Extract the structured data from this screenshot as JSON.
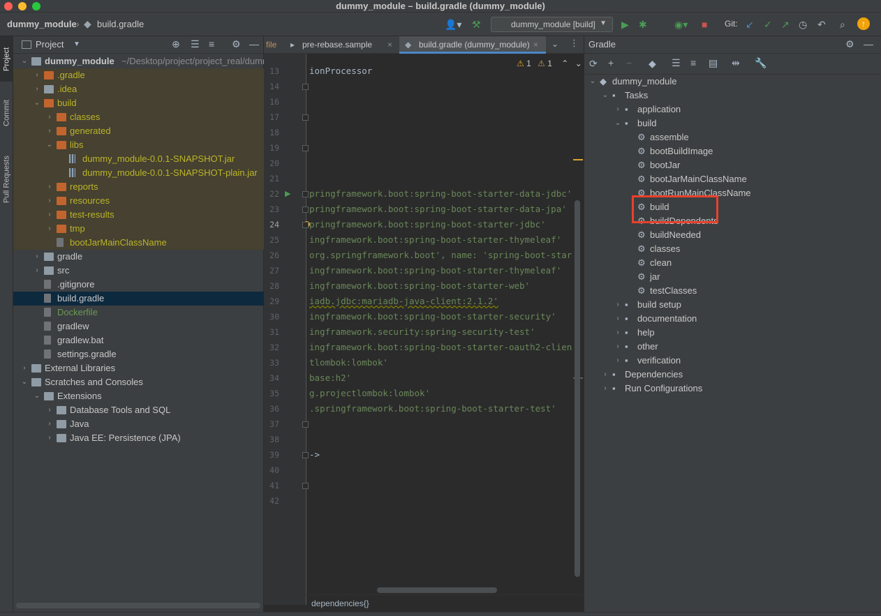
{
  "window": {
    "title": "dummy_module – build.gradle (dummy_module)"
  },
  "navbar": {
    "project": "dummy_module",
    "file": "build.gradle",
    "run_config": "dummy_module [build]",
    "git_label": "Git:"
  },
  "stripe": {
    "tabs": [
      "Project",
      "Commit",
      "Pull Requests"
    ]
  },
  "project_panel": {
    "title": "Project",
    "rows": [
      {
        "name": "dummy_module",
        "path": "~/Desktop/project/project_real/dummy_module",
        "depth": 0,
        "arrow": "down",
        "icon": "folder-gray",
        "color": "white",
        "bold": true
      },
      {
        "name": ".gradle",
        "depth": 1,
        "arrow": "right",
        "icon": "folder-orange",
        "color": "olive",
        "tinted": true
      },
      {
        "name": ".idea",
        "depth": 1,
        "arrow": "right",
        "icon": "folder-gray",
        "color": "olive",
        "tinted": true
      },
      {
        "name": "build",
        "depth": 1,
        "arrow": "down",
        "icon": "folder-orange",
        "color": "olive",
        "tinted": true
      },
      {
        "name": "classes",
        "depth": 2,
        "arrow": "right",
        "icon": "folder-orange",
        "color": "olive",
        "tinted": true
      },
      {
        "name": "generated",
        "depth": 2,
        "arrow": "right",
        "icon": "folder-orange",
        "color": "olive",
        "tinted": true
      },
      {
        "name": "libs",
        "depth": 2,
        "arrow": "down",
        "icon": "folder-orange",
        "color": "olive",
        "tinted": true
      },
      {
        "name": "dummy_module-0.0.1-SNAPSHOT.jar",
        "depth": 3,
        "arrow": "",
        "icon": "jar",
        "color": "olive",
        "tinted": true
      },
      {
        "name": "dummy_module-0.0.1-SNAPSHOT-plain.jar",
        "depth": 3,
        "arrow": "",
        "icon": "jar",
        "color": "olive",
        "tinted": true
      },
      {
        "name": "reports",
        "depth": 2,
        "arrow": "right",
        "icon": "folder-orange",
        "color": "olive",
        "tinted": true
      },
      {
        "name": "resources",
        "depth": 2,
        "arrow": "right",
        "icon": "folder-orange",
        "color": "olive",
        "tinted": true
      },
      {
        "name": "test-results",
        "depth": 2,
        "arrow": "right",
        "icon": "folder-orange",
        "color": "olive",
        "tinted": true
      },
      {
        "name": "tmp",
        "depth": 2,
        "arrow": "right",
        "icon": "folder-orange",
        "color": "olive",
        "tinted": true
      },
      {
        "name": "bootJarMainClassName",
        "depth": 2,
        "arrow": "",
        "icon": "file",
        "color": "olive",
        "tinted": true
      },
      {
        "name": "gradle",
        "depth": 1,
        "arrow": "right",
        "icon": "folder-gray",
        "color": "white"
      },
      {
        "name": "src",
        "depth": 1,
        "arrow": "right",
        "icon": "folder-gray",
        "color": "white"
      },
      {
        "name": ".gitignore",
        "depth": 1,
        "arrow": "",
        "icon": "file",
        "color": "white"
      },
      {
        "name": "build.gradle",
        "depth": 1,
        "arrow": "",
        "icon": "file",
        "color": "white",
        "selected": true
      },
      {
        "name": "Dockerfile",
        "depth": 1,
        "arrow": "",
        "icon": "file",
        "color": "green"
      },
      {
        "name": "gradlew",
        "depth": 1,
        "arrow": "",
        "icon": "file",
        "color": "white"
      },
      {
        "name": "gradlew.bat",
        "depth": 1,
        "arrow": "",
        "icon": "file",
        "color": "white"
      },
      {
        "name": "settings.gradle",
        "depth": 1,
        "arrow": "",
        "icon": "file",
        "color": "white"
      },
      {
        "name": "External Libraries",
        "depth": 0,
        "arrow": "right",
        "icon": "folder-gray",
        "color": "white"
      },
      {
        "name": "Scratches and Consoles",
        "depth": 0,
        "arrow": "down",
        "icon": "folder-gray",
        "color": "white"
      },
      {
        "name": "Extensions",
        "depth": 1,
        "arrow": "down",
        "icon": "folder-gray",
        "color": "white"
      },
      {
        "name": "Database Tools and SQL",
        "depth": 2,
        "arrow": "right",
        "icon": "folder-gray",
        "color": "white"
      },
      {
        "name": "Java",
        "depth": 2,
        "arrow": "right",
        "icon": "folder-gray",
        "color": "white"
      },
      {
        "name": "Java EE: Persistence (JPA)",
        "depth": 2,
        "arrow": "right",
        "icon": "folder-gray",
        "color": "white"
      }
    ]
  },
  "editor": {
    "tabs": [
      {
        "label": "file",
        "active": false
      },
      {
        "label": "pre-rebase.sample",
        "active": false
      },
      {
        "label": "build.gradle (dummy_module)",
        "active": true
      }
    ],
    "warnings": "1",
    "weak_warnings": "1",
    "lines": [
      {
        "n": "13",
        "text": "ionProcessor",
        "kind": "plain"
      },
      {
        "n": "14",
        "text": "",
        "kind": "plain"
      },
      {
        "n": "16",
        "text": "",
        "kind": "plain"
      },
      {
        "n": "17",
        "text": "",
        "kind": "plain"
      },
      {
        "n": "18",
        "text": "",
        "kind": "plain"
      },
      {
        "n": "19",
        "text": "",
        "kind": "plain"
      },
      {
        "n": "20",
        "text": "",
        "kind": "plain"
      },
      {
        "n": "21",
        "text": "",
        "kind": "plain"
      },
      {
        "n": "22",
        "text": "pringframework.boot:spring-boot-starter-data-jdbc'",
        "kind": "str"
      },
      {
        "n": "23",
        "text": "pringframework.boot:spring-boot-starter-data-jpa'",
        "kind": "str"
      },
      {
        "n": "24",
        "text": "pringframework.boot:spring-boot-starter-jdbc'",
        "kind": "str"
      },
      {
        "n": "25",
        "text": "ingframework.boot:spring-boot-starter-thymeleaf'",
        "kind": "str"
      },
      {
        "n": "26",
        "text": "org.springframework.boot', name: 'spring-boot-star",
        "kind": "str"
      },
      {
        "n": "27",
        "text": "ingframework.boot:spring-boot-starter-thymeleaf'",
        "kind": "str"
      },
      {
        "n": "28",
        "text": "ingframework.boot:spring-boot-starter-web'",
        "kind": "str"
      },
      {
        "n": "29",
        "text": "iadb.jdbc:mariadb-java-client:2.1.2'",
        "kind": "str"
      },
      {
        "n": "30",
        "text": "ingframework.boot:spring-boot-starter-security'",
        "kind": "str"
      },
      {
        "n": "31",
        "text": "ingframework.security:spring-security-test'",
        "kind": "str"
      },
      {
        "n": "32",
        "text": "ingframework.boot:spring-boot-starter-oauth2-clien",
        "kind": "str"
      },
      {
        "n": "33",
        "text": "tlombok:lombok'",
        "kind": "str"
      },
      {
        "n": "34",
        "text": "base:h2'",
        "kind": "str"
      },
      {
        "n": "35",
        "text": "g.projectlombok:lombok'",
        "kind": "str"
      },
      {
        "n": "36",
        "text": ".springframework.boot:spring-boot-starter-test'",
        "kind": "str"
      },
      {
        "n": "37",
        "text": "",
        "kind": "plain"
      },
      {
        "n": "38",
        "text": "",
        "kind": "plain"
      },
      {
        "n": "39",
        "text": "->",
        "kind": "plain"
      },
      {
        "n": "40",
        "text": "",
        "kind": "plain"
      },
      {
        "n": "41",
        "text": "",
        "kind": "plain"
      },
      {
        "n": "42",
        "text": "",
        "kind": "plain"
      }
    ],
    "breadcrumb": "dependencies{}"
  },
  "gradle_panel": {
    "title": "Gradle",
    "rows": [
      {
        "name": "dummy_module",
        "depth": 0,
        "arrow": "down",
        "icon": "elephant"
      },
      {
        "name": "Tasks",
        "depth": 1,
        "arrow": "down",
        "icon": "folder"
      },
      {
        "name": "application",
        "depth": 2,
        "arrow": "right",
        "icon": "folder"
      },
      {
        "name": "build",
        "depth": 2,
        "arrow": "down",
        "icon": "folder"
      },
      {
        "name": "assemble",
        "depth": 3,
        "arrow": "",
        "icon": "gear"
      },
      {
        "name": "bootBuildImage",
        "depth": 3,
        "arrow": "",
        "icon": "gear"
      },
      {
        "name": "bootJar",
        "depth": 3,
        "arrow": "",
        "icon": "gear"
      },
      {
        "name": "bootJarMainClassName",
        "depth": 3,
        "arrow": "",
        "icon": "gear"
      },
      {
        "name": "bootRunMainClassName",
        "depth": 3,
        "arrow": "",
        "icon": "gear"
      },
      {
        "name": "build",
        "depth": 3,
        "arrow": "",
        "icon": "gear"
      },
      {
        "name": "buildDependents",
        "depth": 3,
        "arrow": "",
        "icon": "gear"
      },
      {
        "name": "buildNeeded",
        "depth": 3,
        "arrow": "",
        "icon": "gear"
      },
      {
        "name": "classes",
        "depth": 3,
        "arrow": "",
        "icon": "gear"
      },
      {
        "name": "clean",
        "depth": 3,
        "arrow": "",
        "icon": "gear"
      },
      {
        "name": "jar",
        "depth": 3,
        "arrow": "",
        "icon": "gear"
      },
      {
        "name": "testClasses",
        "depth": 3,
        "arrow": "",
        "icon": "gear"
      },
      {
        "name": "build setup",
        "depth": 2,
        "arrow": "right",
        "icon": "folder"
      },
      {
        "name": "documentation",
        "depth": 2,
        "arrow": "right",
        "icon": "folder"
      },
      {
        "name": "help",
        "depth": 2,
        "arrow": "right",
        "icon": "folder"
      },
      {
        "name": "other",
        "depth": 2,
        "arrow": "right",
        "icon": "folder"
      },
      {
        "name": "verification",
        "depth": 2,
        "arrow": "right",
        "icon": "folder"
      },
      {
        "name": "Dependencies",
        "depth": 1,
        "arrow": "right",
        "icon": "folder"
      },
      {
        "name": "Run Configurations",
        "depth": 1,
        "arrow": "right",
        "icon": "folder"
      }
    ]
  },
  "colors": {
    "accent": "#4a88c7",
    "highlight_box": "#e8412c",
    "run_green": "#499c54",
    "stop_red": "#c75450"
  }
}
